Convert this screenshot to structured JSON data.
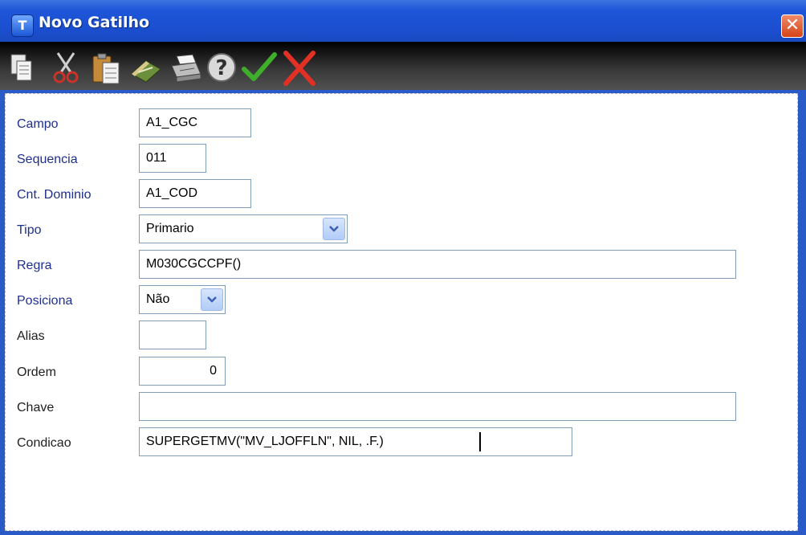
{
  "window": {
    "title": "Novo Gatilho",
    "icon_letter": "T",
    "close_label": "✕"
  },
  "toolbar": {
    "items": [
      {
        "name": "copy-icon"
      },
      {
        "name": "cut-icon"
      },
      {
        "name": "paste-icon"
      },
      {
        "name": "eraser-icon"
      },
      {
        "name": "print-icon"
      },
      {
        "name": "help-icon"
      },
      {
        "name": "confirm-check-icon"
      },
      {
        "name": "cancel-x-icon"
      }
    ]
  },
  "form": {
    "campo": {
      "label": "Campo",
      "value": "A1_CGC"
    },
    "sequencia": {
      "label": "Sequencia",
      "value": "011"
    },
    "cnt_dominio": {
      "label": "Cnt. Dominio",
      "value": "A1_COD"
    },
    "tipo": {
      "label": "Tipo",
      "value": "Primario"
    },
    "regra": {
      "label": "Regra",
      "value": "M030CGCCPF()"
    },
    "posiciona": {
      "label": "Posiciona",
      "value": "Não"
    },
    "alias": {
      "label": "Alias",
      "value": ""
    },
    "ordem": {
      "label": "Ordem",
      "value": "0"
    },
    "chave": {
      "label": "Chave",
      "value": ""
    },
    "condicao": {
      "label": "Condicao",
      "value": "SUPERGETMV(\"MV_LJOFFLN\", NIL, .F.)"
    }
  },
  "colors": {
    "titlebar": "#1e55d8",
    "label_blue": "#1d2f8f",
    "field_border": "#7f9db9"
  }
}
